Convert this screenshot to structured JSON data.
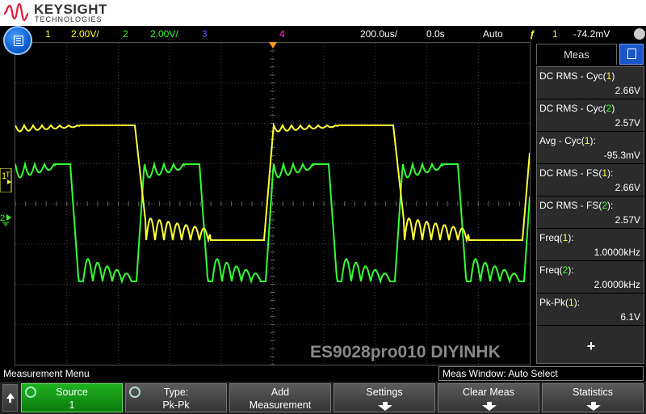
{
  "brand": {
    "name": "KEYSIGHT",
    "subtitle": "TECHNOLOGIES"
  },
  "status": {
    "ch1_num": "1",
    "ch1_scale": "2.00V/",
    "ch2_num": "2",
    "ch2_scale": "2.00V/",
    "ch3_num": "3",
    "ch4_num": "4",
    "timebase": "200.0us/",
    "delay": "0.0s",
    "trigger_mode": "Auto",
    "trigger_symbol": "ƒ",
    "trigger_source": "1",
    "trigger_level": "-74.2mV"
  },
  "colors": {
    "ch1": "#ffff33",
    "ch2": "#33ff33",
    "ch3": "#5566ff",
    "ch4": "#ff33cc",
    "grid": "#444444"
  },
  "markers": {
    "ch1": "1",
    "ch2": "2",
    "trigger": "T"
  },
  "watermark": "ES9028pro010 DIYINHK",
  "meas_panel": {
    "tab_label": "Meas",
    "add_label": "+",
    "items": [
      {
        "label_pre": "DC RMS - Cyc(",
        "channel": "1",
        "label_post": ")",
        "value": "2.66V"
      },
      {
        "label_pre": "DC RMS - Cyc(",
        "channel": "2",
        "label_post": ")",
        "value": "2.57V"
      },
      {
        "label_pre": "Avg - Cyc(",
        "channel": "1",
        "label_post": "):",
        "value": "-95.3mV"
      },
      {
        "label_pre": "DC RMS - FS(",
        "channel": "1",
        "label_post": "):",
        "value": "2.66V"
      },
      {
        "label_pre": "DC RMS - FS(",
        "channel": "2",
        "label_post": "):",
        "value": "2.57V"
      },
      {
        "label_pre": "Freq(",
        "channel": "1",
        "label_post": "):",
        "value": "1.0000kHz"
      },
      {
        "label_pre": "Freq(",
        "channel": "2",
        "label_post": "):",
        "value": "2.0000kHz"
      },
      {
        "label_pre": "Pk-Pk(",
        "channel": "1",
        "label_post": "):",
        "value": "6.1V"
      }
    ]
  },
  "menu_title": "Measurement Menu",
  "meas_window": "Meas Window: Auto Select",
  "softkeys": {
    "source": {
      "line1": "Source",
      "line2": "1"
    },
    "type": {
      "line1": "Type:",
      "line2": "Pk-Pk"
    },
    "add": {
      "line1": "Add",
      "line2": "Measurement"
    },
    "settings": {
      "line1": "Settings"
    },
    "clear": {
      "line1": "Clear Meas"
    },
    "statistics": {
      "line1": "Statistics"
    }
  }
}
